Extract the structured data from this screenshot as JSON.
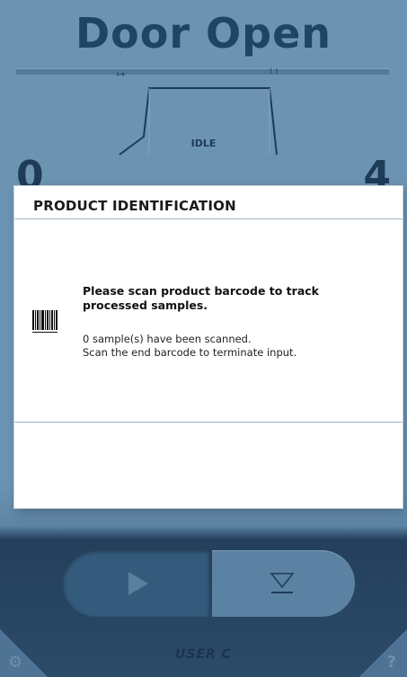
{
  "header": {
    "status_title": "Door Open"
  },
  "process": {
    "phase_label": "IDLE",
    "left_count": "0",
    "right_count": "4"
  },
  "controls": {
    "user_label": "USER C"
  },
  "icons": {
    "play": "play-icon",
    "eject": "eject-icon",
    "settings": "gear-icon",
    "help": "help-icon",
    "barcode": "barcode-icon"
  },
  "dialog": {
    "title": "PRODUCT IDENTIFICATION",
    "instruction": "Please scan product barcode to track processed samples.",
    "scanned_status": "0 sample(s) have been scanned.",
    "terminate_hint": "Scan the end barcode to terminate input."
  },
  "colors": {
    "background": "#6c93b2",
    "title_text": "#1e4466",
    "control_dark": "#345a7c",
    "dialog_bg": "#ffffff"
  }
}
